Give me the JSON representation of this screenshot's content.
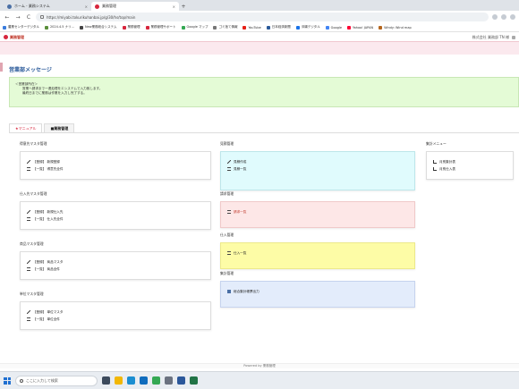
{
  "browser": {
    "tabs": [
      {
        "label": "ホーム - 業務システム",
        "active": false,
        "color": "#4a6fa5"
      },
      {
        "label": "業務管理",
        "active": true,
        "color": "#d7263d"
      }
    ],
    "new_tab": "+",
    "tab_close": "×",
    "nav": {
      "back": "←",
      "forward": "→",
      "reload": "C"
    },
    "url": "https://miyabi.tokurikuhanbai.jp/g/30/hs/top/main",
    "bookmarks": [
      {
        "label": "農業センターデジタル",
        "color": "#3b7ddd"
      },
      {
        "label": "2024.4.5 ナリ...",
        "color": "#5a8f3a"
      },
      {
        "label": "New業務総合システム",
        "color": "#444444"
      },
      {
        "label": "業務管理",
        "color": "#d7263d"
      },
      {
        "label": "業務管理サポート",
        "color": "#d7263d"
      },
      {
        "label": "Google マップ",
        "color": "#34a853"
      },
      {
        "label": "ゴミ捨て情報",
        "color": "#777777"
      },
      {
        "label": "YouTube",
        "color": "#e62117"
      },
      {
        "label": "日本経済新聞",
        "color": "#2a5a9a"
      },
      {
        "label": "沖縄デジタル",
        "color": "#1a73e8"
      },
      {
        "label": "Google",
        "color": "#4285f4"
      },
      {
        "label": "Yahoo! JAPAN",
        "color": "#ff0033"
      },
      {
        "label": "Windy: Wind map",
        "color": "#b5651d"
      }
    ]
  },
  "app": {
    "logo_text": "業務管理",
    "user_text": "株式会社 業務部 TN 様",
    "page_title": "営業部メッセージ",
    "notice": {
      "line1": "＜営業部所在＞",
      "line2": "営業へ請求まで一連処理をエシステムで入力致します。",
      "line3": "最終日までに業務は作業を入力し完了する。"
    },
    "tabs": {
      "manual": "★マニュアル",
      "business": "■業務管理"
    },
    "sections": {
      "customer": {
        "title": "得意先マスタ管理",
        "items": [
          "【登録】 新規登録",
          "【一覧】 得意先全件"
        ]
      },
      "supplier": {
        "title": "仕入先マスタ管理",
        "items": [
          "【登録】 新規仕入先",
          "【一覧】 仕入先全件"
        ]
      },
      "product": {
        "title": "商品マスタ管理",
        "items": [
          "【登録】 商品マスタ",
          "【一覧】 商品全件"
        ]
      },
      "sales_master": {
        "title": "単位マスタ管理",
        "items": [
          "【登録】 単位マスタ",
          "【一覧】 単位全件"
        ]
      },
      "estimate": {
        "title": "見積管理",
        "items": [
          "見積作成",
          "見積一覧"
        ]
      },
      "invoice": {
        "title": "請求管理",
        "items": [
          "請求一覧"
        ]
      },
      "purchase": {
        "title": "仕入管理",
        "items": [
          "仕入一覧"
        ]
      },
      "report": {
        "title": "集計管理",
        "items": [
          "総合集計帳票出力"
        ]
      },
      "menu": {
        "title": "集計メニュー",
        "items": [
          "月別集計表",
          "月別仕入表"
        ]
      }
    },
    "footer": "Powered by 業務管理"
  },
  "taskbar": {
    "search_placeholder": "ここに入力して検索",
    "icons": [
      {
        "name": "task-view-icon",
        "color": "#3c4a5c"
      },
      {
        "name": "file-explorer-icon",
        "color": "#f2b705"
      },
      {
        "name": "edge-icon",
        "color": "#1b8ed1"
      },
      {
        "name": "outlook-icon",
        "color": "#0f6cbd"
      },
      {
        "name": "chrome-icon",
        "color": "#34a853"
      },
      {
        "name": "settings-icon",
        "color": "#6b7280"
      },
      {
        "name": "word-icon",
        "color": "#2b579a"
      },
      {
        "name": "excel-icon",
        "color": "#217346"
      }
    ]
  }
}
